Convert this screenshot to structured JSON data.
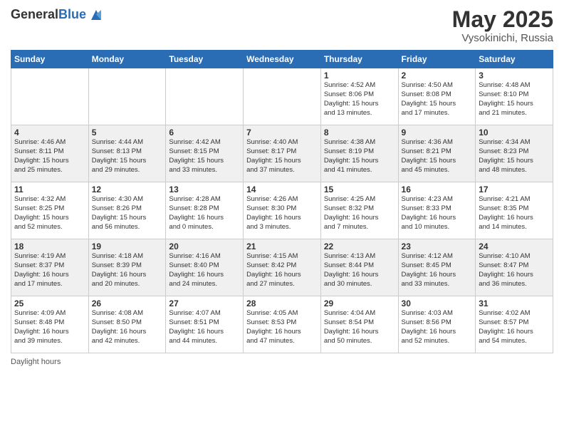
{
  "header": {
    "logo_general": "General",
    "logo_blue": "Blue",
    "title": "May 2025",
    "location": "Vysokinichi, Russia"
  },
  "days_of_week": [
    "Sunday",
    "Monday",
    "Tuesday",
    "Wednesday",
    "Thursday",
    "Friday",
    "Saturday"
  ],
  "footer": {
    "note": "Daylight hours"
  },
  "weeks": [
    {
      "row_bg": "odd",
      "days": [
        {
          "num": "",
          "info": ""
        },
        {
          "num": "",
          "info": ""
        },
        {
          "num": "",
          "info": ""
        },
        {
          "num": "",
          "info": ""
        },
        {
          "num": "1",
          "info": "Sunrise: 4:52 AM\nSunset: 8:06 PM\nDaylight: 15 hours\nand 13 minutes."
        },
        {
          "num": "2",
          "info": "Sunrise: 4:50 AM\nSunset: 8:08 PM\nDaylight: 15 hours\nand 17 minutes."
        },
        {
          "num": "3",
          "info": "Sunrise: 4:48 AM\nSunset: 8:10 PM\nDaylight: 15 hours\nand 21 minutes."
        }
      ]
    },
    {
      "row_bg": "even",
      "days": [
        {
          "num": "4",
          "info": "Sunrise: 4:46 AM\nSunset: 8:11 PM\nDaylight: 15 hours\nand 25 minutes."
        },
        {
          "num": "5",
          "info": "Sunrise: 4:44 AM\nSunset: 8:13 PM\nDaylight: 15 hours\nand 29 minutes."
        },
        {
          "num": "6",
          "info": "Sunrise: 4:42 AM\nSunset: 8:15 PM\nDaylight: 15 hours\nand 33 minutes."
        },
        {
          "num": "7",
          "info": "Sunrise: 4:40 AM\nSunset: 8:17 PM\nDaylight: 15 hours\nand 37 minutes."
        },
        {
          "num": "8",
          "info": "Sunrise: 4:38 AM\nSunset: 8:19 PM\nDaylight: 15 hours\nand 41 minutes."
        },
        {
          "num": "9",
          "info": "Sunrise: 4:36 AM\nSunset: 8:21 PM\nDaylight: 15 hours\nand 45 minutes."
        },
        {
          "num": "10",
          "info": "Sunrise: 4:34 AM\nSunset: 8:23 PM\nDaylight: 15 hours\nand 48 minutes."
        }
      ]
    },
    {
      "row_bg": "odd",
      "days": [
        {
          "num": "11",
          "info": "Sunrise: 4:32 AM\nSunset: 8:25 PM\nDaylight: 15 hours\nand 52 minutes."
        },
        {
          "num": "12",
          "info": "Sunrise: 4:30 AM\nSunset: 8:26 PM\nDaylight: 15 hours\nand 56 minutes."
        },
        {
          "num": "13",
          "info": "Sunrise: 4:28 AM\nSunset: 8:28 PM\nDaylight: 16 hours\nand 0 minutes."
        },
        {
          "num": "14",
          "info": "Sunrise: 4:26 AM\nSunset: 8:30 PM\nDaylight: 16 hours\nand 3 minutes."
        },
        {
          "num": "15",
          "info": "Sunrise: 4:25 AM\nSunset: 8:32 PM\nDaylight: 16 hours\nand 7 minutes."
        },
        {
          "num": "16",
          "info": "Sunrise: 4:23 AM\nSunset: 8:33 PM\nDaylight: 16 hours\nand 10 minutes."
        },
        {
          "num": "17",
          "info": "Sunrise: 4:21 AM\nSunset: 8:35 PM\nDaylight: 16 hours\nand 14 minutes."
        }
      ]
    },
    {
      "row_bg": "even",
      "days": [
        {
          "num": "18",
          "info": "Sunrise: 4:19 AM\nSunset: 8:37 PM\nDaylight: 16 hours\nand 17 minutes."
        },
        {
          "num": "19",
          "info": "Sunrise: 4:18 AM\nSunset: 8:39 PM\nDaylight: 16 hours\nand 20 minutes."
        },
        {
          "num": "20",
          "info": "Sunrise: 4:16 AM\nSunset: 8:40 PM\nDaylight: 16 hours\nand 24 minutes."
        },
        {
          "num": "21",
          "info": "Sunrise: 4:15 AM\nSunset: 8:42 PM\nDaylight: 16 hours\nand 27 minutes."
        },
        {
          "num": "22",
          "info": "Sunrise: 4:13 AM\nSunset: 8:44 PM\nDaylight: 16 hours\nand 30 minutes."
        },
        {
          "num": "23",
          "info": "Sunrise: 4:12 AM\nSunset: 8:45 PM\nDaylight: 16 hours\nand 33 minutes."
        },
        {
          "num": "24",
          "info": "Sunrise: 4:10 AM\nSunset: 8:47 PM\nDaylight: 16 hours\nand 36 minutes."
        }
      ]
    },
    {
      "row_bg": "odd",
      "days": [
        {
          "num": "25",
          "info": "Sunrise: 4:09 AM\nSunset: 8:48 PM\nDaylight: 16 hours\nand 39 minutes."
        },
        {
          "num": "26",
          "info": "Sunrise: 4:08 AM\nSunset: 8:50 PM\nDaylight: 16 hours\nand 42 minutes."
        },
        {
          "num": "27",
          "info": "Sunrise: 4:07 AM\nSunset: 8:51 PM\nDaylight: 16 hours\nand 44 minutes."
        },
        {
          "num": "28",
          "info": "Sunrise: 4:05 AM\nSunset: 8:53 PM\nDaylight: 16 hours\nand 47 minutes."
        },
        {
          "num": "29",
          "info": "Sunrise: 4:04 AM\nSunset: 8:54 PM\nDaylight: 16 hours\nand 50 minutes."
        },
        {
          "num": "30",
          "info": "Sunrise: 4:03 AM\nSunset: 8:56 PM\nDaylight: 16 hours\nand 52 minutes."
        },
        {
          "num": "31",
          "info": "Sunrise: 4:02 AM\nSunset: 8:57 PM\nDaylight: 16 hours\nand 54 minutes."
        }
      ]
    }
  ]
}
